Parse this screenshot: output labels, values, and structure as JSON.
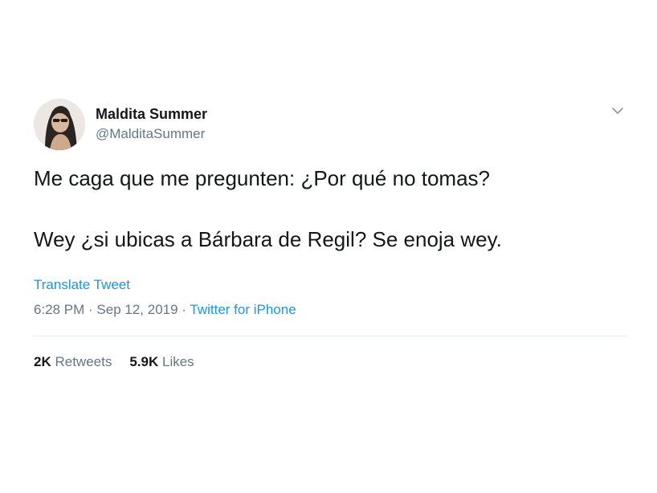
{
  "user": {
    "display_name": "Maldita Summer",
    "handle": "@MalditaSummer"
  },
  "tweet": {
    "paragraphs": [
      "Me caga que me pregunten: ¿Por qué no tomas?",
      "Wey ¿si ubicas a Bárbara de Regil? Se enoja wey."
    ],
    "translate_label": "Translate Tweet",
    "time": "6:28 PM",
    "separator": " · ",
    "date": "Sep 12, 2019",
    "source": "Twitter for iPhone"
  },
  "stats": {
    "retweets_count": "2K",
    "retweets_label": "Retweets",
    "likes_count": "5.9K",
    "likes_label": "Likes"
  },
  "icons": {
    "menu": "chevron-down-icon",
    "avatar": "avatar"
  },
  "colors": {
    "text": "#14171a",
    "secondary": "#657786",
    "link": "#1b95e0",
    "divider": "#e6ecf0"
  }
}
